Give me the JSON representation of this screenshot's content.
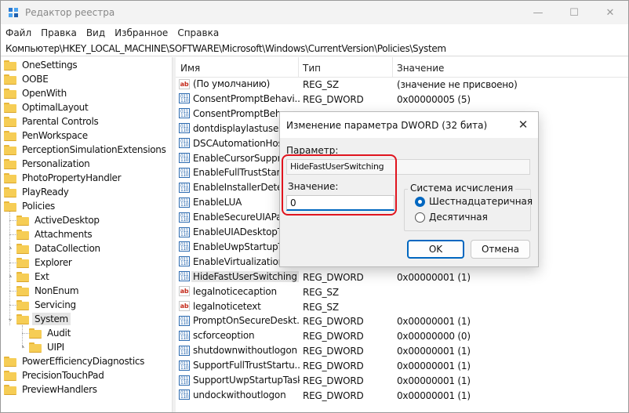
{
  "window": {
    "title": "Редактор реестра",
    "minimize_glyph": "—",
    "maximize_glyph": "☐",
    "close_glyph": "✕"
  },
  "menu": [
    "Файл",
    "Правка",
    "Вид",
    "Избранное",
    "Справка"
  ],
  "address": "Компьютер\\HKEY_LOCAL_MACHINE\\SOFTWARE\\Microsoft\\Windows\\CurrentVersion\\Policies\\System",
  "tree": [
    {
      "label": "OneSettings",
      "level": 0,
      "chevron": ""
    },
    {
      "label": "OOBE",
      "level": 0,
      "chevron": ""
    },
    {
      "label": "OpenWith",
      "level": 0,
      "chevron": ""
    },
    {
      "label": "OptimalLayout",
      "level": 0,
      "chevron": ""
    },
    {
      "label": "Parental Controls",
      "level": 0,
      "chevron": ""
    },
    {
      "label": "PenWorkspace",
      "level": 0,
      "chevron": ""
    },
    {
      "label": "PerceptionSimulationExtensions",
      "level": 0,
      "chevron": ""
    },
    {
      "label": "Personalization",
      "level": 0,
      "chevron": ""
    },
    {
      "label": "PhotoPropertyHandler",
      "level": 0,
      "chevron": ""
    },
    {
      "label": "PlayReady",
      "level": 0,
      "chevron": ""
    },
    {
      "label": "Policies",
      "level": 0,
      "chevron": ""
    },
    {
      "label": "ActiveDesktop",
      "level": 1,
      "chevron": ""
    },
    {
      "label": "Attachments",
      "level": 1,
      "chevron": ""
    },
    {
      "label": "DataCollection",
      "level": 1,
      "chevron": "›"
    },
    {
      "label": "Explorer",
      "level": 1,
      "chevron": ""
    },
    {
      "label": "Ext",
      "level": 1,
      "chevron": "›"
    },
    {
      "label": "NonEnum",
      "level": 1,
      "chevron": ""
    },
    {
      "label": "Servicing",
      "level": 1,
      "chevron": ""
    },
    {
      "label": "System",
      "level": 1,
      "chevron": "⌄",
      "selected": true
    },
    {
      "label": "Audit",
      "level": 2,
      "chevron": ""
    },
    {
      "label": "UIPI",
      "level": 2,
      "chevron": "›"
    },
    {
      "label": "PowerEfficiencyDiagnostics",
      "level": 0,
      "chevron": ""
    },
    {
      "label": "PrecisionTouchPad",
      "level": 0,
      "chevron": ""
    },
    {
      "label": "PreviewHandlers",
      "level": 0,
      "chevron": ""
    }
  ],
  "list": {
    "headers": {
      "name": "Имя",
      "type": "Тип",
      "value": "Значение"
    },
    "rows": [
      {
        "name": "(По умолчанию)",
        "type": "REG_SZ",
        "value": "(значение не присвоено)",
        "kind": "sz"
      },
      {
        "name": "ConsentPromptBehavi...",
        "type": "REG_DWORD",
        "value": "0x00000005 (5)",
        "kind": "dw"
      },
      {
        "name": "ConsentPromptBeha...",
        "type": "",
        "value": "",
        "kind": "dw"
      },
      {
        "name": "dontdisplaylastuserna...",
        "type": "",
        "value": "",
        "kind": "dw"
      },
      {
        "name": "DSCAutomationHost...",
        "type": "",
        "value": "",
        "kind": "dw"
      },
      {
        "name": "EnableCursorSuppre...",
        "type": "",
        "value": "",
        "kind": "dw"
      },
      {
        "name": "EnableFullTrustStartu...",
        "type": "",
        "value": "",
        "kind": "dw"
      },
      {
        "name": "EnableInstallerDetect...",
        "type": "",
        "value": "",
        "kind": "dw"
      },
      {
        "name": "EnableLUA",
        "type": "",
        "value": "",
        "kind": "dw"
      },
      {
        "name": "EnableSecureUIAPath...",
        "type": "",
        "value": "",
        "kind": "dw"
      },
      {
        "name": "EnableUIADesktopTo...",
        "type": "",
        "value": "",
        "kind": "dw"
      },
      {
        "name": "EnableUwpStartupTask...",
        "type": "",
        "value": "",
        "kind": "dw"
      },
      {
        "name": "EnableVirtualization",
        "type": "",
        "value": "",
        "kind": "dw"
      },
      {
        "name": "HideFastUserSwitching",
        "type": "REG_DWORD",
        "value": "0x00000001 (1)",
        "kind": "dw",
        "selected": true
      },
      {
        "name": "legalnoticecaption",
        "type": "REG_SZ",
        "value": "",
        "kind": "sz"
      },
      {
        "name": "legalnoticetext",
        "type": "REG_SZ",
        "value": "",
        "kind": "sz"
      },
      {
        "name": "PromptOnSecureDeskt...",
        "type": "REG_DWORD",
        "value": "0x00000001 (1)",
        "kind": "dw"
      },
      {
        "name": "scforceoption",
        "type": "REG_DWORD",
        "value": "0x00000000 (0)",
        "kind": "dw"
      },
      {
        "name": "shutdownwithoutlogon",
        "type": "REG_DWORD",
        "value": "0x00000001 (1)",
        "kind": "dw"
      },
      {
        "name": "SupportFullTrustStartu...",
        "type": "REG_DWORD",
        "value": "0x00000001 (1)",
        "kind": "dw"
      },
      {
        "name": "SupportUwpStartupTasks",
        "type": "REG_DWORD",
        "value": "0x00000001 (1)",
        "kind": "dw"
      },
      {
        "name": "undockwithoutlogon",
        "type": "REG_DWORD",
        "value": "0x00000001 (1)",
        "kind": "dw"
      }
    ]
  },
  "dialog": {
    "title": "Изменение параметра DWORD (32 бита)",
    "close_glyph": "✕",
    "param_label": "Параметр:",
    "param_value": "HideFastUserSwitching",
    "value_label": "Значение:",
    "value": "0",
    "base_group": "Система исчисления",
    "radio_hex": "Шестнадцатеричная",
    "radio_dec": "Десятичная",
    "selected_base": "hex",
    "ok_label": "OK",
    "cancel_label": "Отмена",
    "highlight_color": "#e0141e",
    "accent_color": "#0067c0"
  }
}
